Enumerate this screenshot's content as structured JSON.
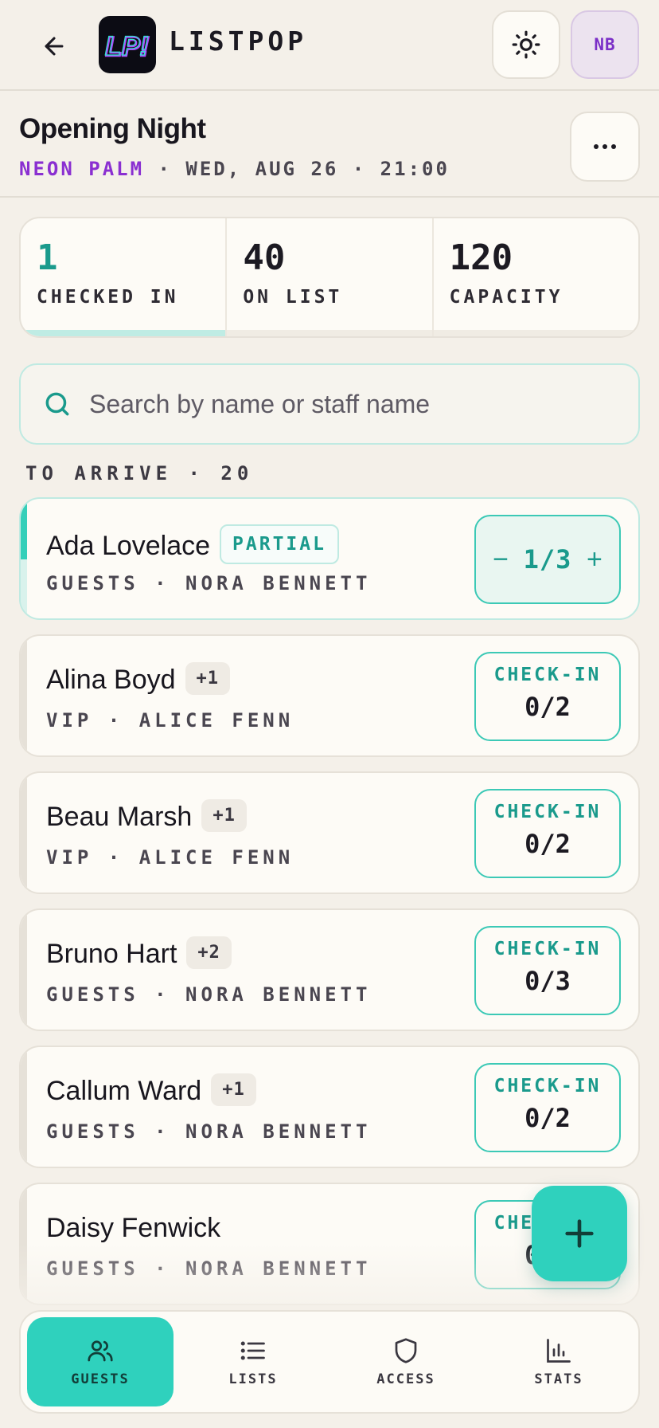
{
  "header": {
    "back_icon": "arrow-left-icon",
    "logo_text": "LP!",
    "brand": "LISTPOP",
    "theme_icon": "sun-icon",
    "avatar_initials": "NB"
  },
  "event": {
    "title": "Opening Night",
    "venue": "NEON PALM",
    "details": " · WED, AUG 26 · 21:00",
    "more_icon": "more-horizontal-icon"
  },
  "stats": [
    {
      "value": "1",
      "label": "CHECKED IN"
    },
    {
      "value": "40",
      "label": "ON LIST"
    },
    {
      "value": "120",
      "label": "CAPACITY"
    }
  ],
  "search": {
    "placeholder": "Search by name or staff name",
    "value": ""
  },
  "section": {
    "label": "TO ARRIVE · 20"
  },
  "guests": [
    {
      "name": "Ada Lovelace",
      "badge": "PARTIAL",
      "meta": "GUESTS · NORA BENNETT",
      "count": "1/3",
      "minus": "−",
      "plus": "+"
    },
    {
      "name": "Alina Boyd",
      "badge": "+1",
      "meta": "VIP · ALICE FENN",
      "action": "CHECK-IN",
      "count": "0/2"
    },
    {
      "name": "Beau Marsh",
      "badge": "+1",
      "meta": "VIP · ALICE FENN",
      "action": "CHECK-IN",
      "count": "0/2"
    },
    {
      "name": "Bruno Hart",
      "badge": "+2",
      "meta": "GUESTS · NORA BENNETT",
      "action": "CHECK-IN",
      "count": "0/3"
    },
    {
      "name": "Callum Ward",
      "badge": "+1",
      "meta": "GUESTS · NORA BENNETT",
      "action": "CHECK-IN",
      "count": "0/2"
    },
    {
      "name": "Daisy Fenwick",
      "meta": "GUESTS · NORA BENNETT",
      "action": "CHECK-IN",
      "count": "0/2"
    }
  ],
  "fab": {
    "icon": "plus-icon"
  },
  "nav": [
    {
      "label": "GUESTS",
      "icon": "users-icon"
    },
    {
      "label": "LISTS",
      "icon": "list-icon"
    },
    {
      "label": "ACCESS",
      "icon": "shield-icon"
    },
    {
      "label": "STATS",
      "icon": "bar-chart-icon"
    }
  ],
  "colors": {
    "accent": "#2fd1bd",
    "accent_text": "#1a9a8c",
    "venue": "#8a2fd1",
    "background": "#f4f0e9"
  }
}
